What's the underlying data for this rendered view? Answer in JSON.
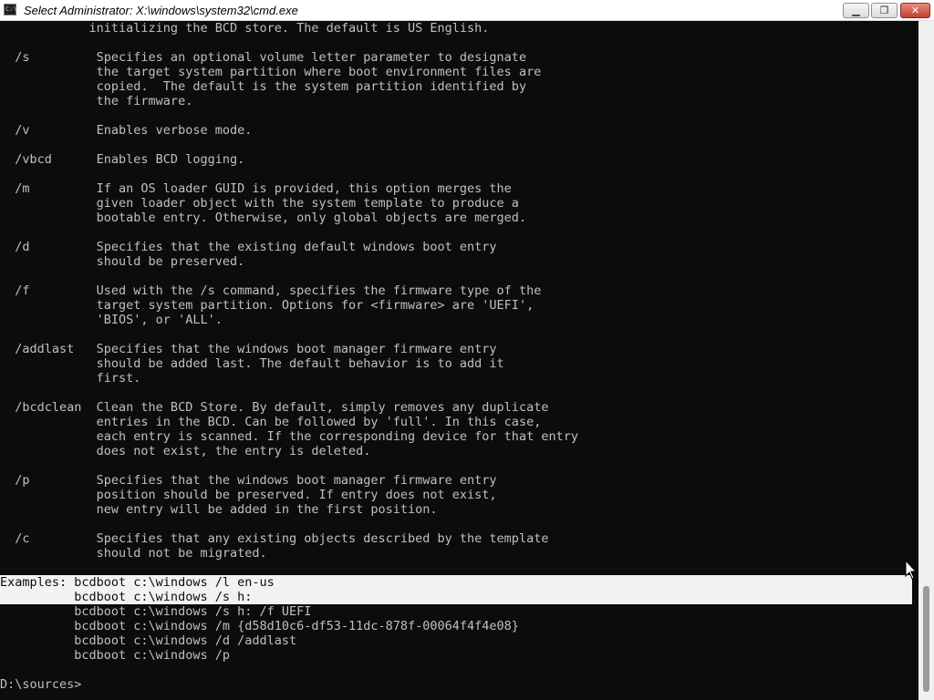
{
  "window": {
    "title": "Select Administrator: X:\\windows\\system32\\cmd.exe",
    "icon_label": "C:\\",
    "buttons": {
      "minimize": "▁",
      "maximize": "❐",
      "close": "✕"
    }
  },
  "console": {
    "lines": [
      "            initializing the BCD store. The default is US English.",
      "",
      "  /s         Specifies an optional volume letter parameter to designate",
      "             the target system partition where boot environment files are",
      "             copied.  The default is the system partition identified by",
      "             the firmware.",
      "",
      "  /v         Enables verbose mode.",
      "",
      "  /vbcd      Enables BCD logging.",
      "",
      "  /m         If an OS loader GUID is provided, this option merges the",
      "             given loader object with the system template to produce a",
      "             bootable entry. Otherwise, only global objects are merged.",
      "",
      "  /d         Specifies that the existing default windows boot entry",
      "             should be preserved.",
      "",
      "  /f         Used with the /s command, specifies the firmware type of the",
      "             target system partition. Options for <firmware> are 'UEFI',",
      "             'BIOS', or 'ALL'.",
      "",
      "  /addlast   Specifies that the windows boot manager firmware entry",
      "             should be added last. The default behavior is to add it",
      "             first.",
      "",
      "  /bcdclean  Clean the BCD Store. By default, simply removes any duplicate",
      "             entries in the BCD. Can be followed by 'full'. In this case,",
      "             each entry is scanned. If the corresponding device for that entry",
      "             does not exist, the entry is deleted.",
      "",
      "  /p         Specifies that the windows boot manager firmware entry",
      "             position should be preserved. If entry does not exist,",
      "             new entry will be added in the first position.",
      "",
      "  /c         Specifies that any existing objects described by the template",
      "             should not be migrated.",
      "",
      "Examples: bcdboot c:\\windows /l en-us",
      "          bcdboot c:\\windows /s h:",
      "          bcdboot c:\\windows /s h: /f UEFI",
      "          bcdboot c:\\windows /m {d58d10c6-df53-11dc-878f-00064f4f4e08}",
      "          bcdboot c:\\windows /d /addlast",
      "          bcdboot c:\\windows /p",
      "",
      "D:\\sources>"
    ],
    "selected_lines": [
      38,
      39
    ]
  }
}
